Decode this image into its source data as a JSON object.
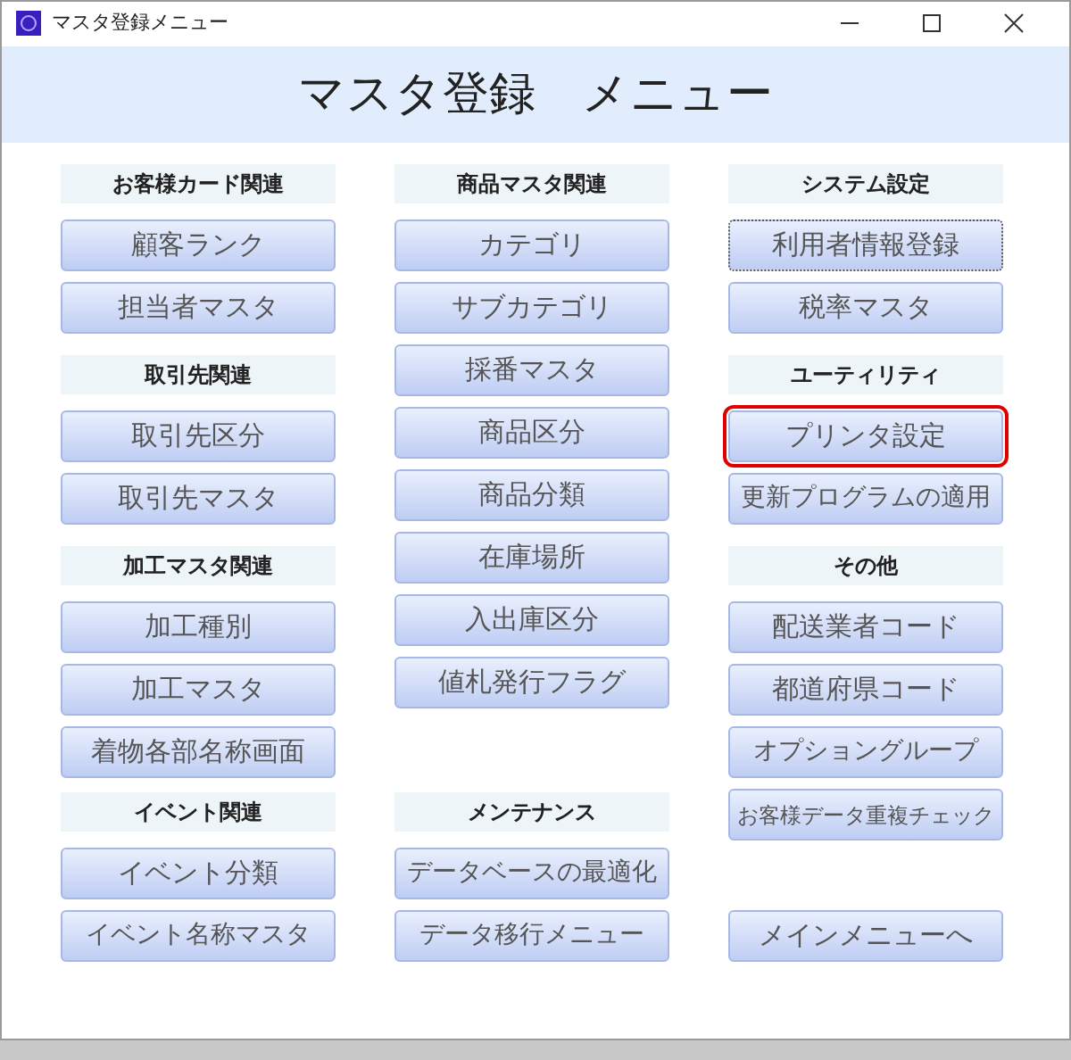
{
  "window": {
    "title": "マスタ登録メニュー"
  },
  "heading": "マスタ登録　メニュー",
  "columns": [
    {
      "sections": [
        {
          "header": "お客様カード関連",
          "buttons": [
            {
              "label": "顧客ランク",
              "focused": false,
              "highlighted": false
            },
            {
              "label": "担当者マスタ",
              "focused": false,
              "highlighted": false
            }
          ]
        },
        {
          "header": "取引先関連",
          "buttons": [
            {
              "label": "取引先区分",
              "focused": false,
              "highlighted": false
            },
            {
              "label": "取引先マスタ",
              "focused": false,
              "highlighted": false
            }
          ]
        },
        {
          "header": "加工マスタ関連",
          "buttons": [
            {
              "label": "加工種別",
              "focused": false,
              "highlighted": false
            },
            {
              "label": "加工マスタ",
              "focused": false,
              "highlighted": false
            },
            {
              "label": "着物各部名称画面",
              "focused": false,
              "highlighted": false
            }
          ]
        },
        {
          "header": "イベント関連",
          "buttons": [
            {
              "label": "イベント分類",
              "focused": false,
              "highlighted": false
            },
            {
              "label": "イベント名称マスタ",
              "focused": false,
              "highlighted": false
            }
          ]
        }
      ]
    },
    {
      "sections": [
        {
          "header": "商品マスタ関連",
          "buttons": [
            {
              "label": "カテゴリ",
              "focused": false,
              "highlighted": false
            },
            {
              "label": "サブカテゴリ",
              "focused": false,
              "highlighted": false
            },
            {
              "label": "採番マスタ",
              "focused": false,
              "highlighted": false
            },
            {
              "label": "商品区分",
              "focused": false,
              "highlighted": false
            },
            {
              "label": "商品分類",
              "focused": false,
              "highlighted": false
            },
            {
              "label": "在庫場所",
              "focused": false,
              "highlighted": false
            },
            {
              "label": "入出庫区分",
              "focused": false,
              "highlighted": false
            },
            {
              "label": "値札発行フラグ",
              "focused": false,
              "highlighted": false
            }
          ]
        },
        {
          "header": "メンテナンス",
          "buttons": [
            {
              "label": "データベースの最適化",
              "focused": false,
              "highlighted": false
            },
            {
              "label": "データ移行メニュー",
              "focused": false,
              "highlighted": false
            }
          ]
        }
      ]
    },
    {
      "sections": [
        {
          "header": "システム設定",
          "buttons": [
            {
              "label": "利用者情報登録",
              "focused": true,
              "highlighted": false
            },
            {
              "label": "税率マスタ",
              "focused": false,
              "highlighted": false
            }
          ]
        },
        {
          "header": "ユーティリティ",
          "buttons": [
            {
              "label": "プリンタ設定",
              "focused": false,
              "highlighted": true
            },
            {
              "label": "更新プログラムの適用",
              "focused": false,
              "highlighted": false
            }
          ]
        },
        {
          "header": "その他",
          "buttons": [
            {
              "label": "配送業者コード",
              "focused": false,
              "highlighted": false
            },
            {
              "label": "都道府県コード",
              "focused": false,
              "highlighted": false
            },
            {
              "label": "オプショングループ",
              "focused": false,
              "highlighted": false
            },
            {
              "label": "お客様データ重複チェック",
              "focused": false,
              "highlighted": false
            }
          ]
        },
        {
          "buttons": [
            {
              "label": "メインメニューへ",
              "focused": false,
              "highlighted": false
            }
          ]
        }
      ]
    }
  ]
}
